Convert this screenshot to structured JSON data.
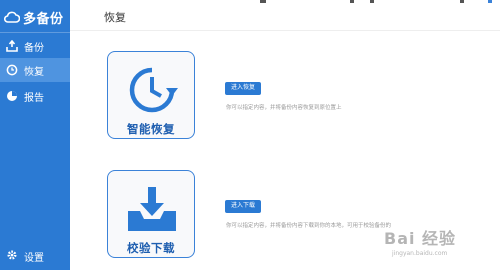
{
  "app": {
    "logo_text": "多备份"
  },
  "sidebar": {
    "items": [
      {
        "label": "备份",
        "icon": "backup-upload-icon"
      },
      {
        "label": "恢复",
        "icon": "history-icon",
        "active": true
      },
      {
        "label": "报告",
        "icon": "pie-chart-icon"
      }
    ],
    "settings_label": "设置"
  },
  "page": {
    "title": "恢复"
  },
  "restore": {
    "card_label": "智能恢复",
    "button_label": "进入恢复",
    "description": "你可以指定内容，并将备份内容恢复到原位置上"
  },
  "download": {
    "card_label": "校验下载",
    "button_label": "进入下载",
    "description": "你可以指定内容，并将备份内容下载到你的本地，可用于校验备份的"
  },
  "watermark": {
    "text": "Bai 经验",
    "sub": "jingyan.baidu.com"
  },
  "colors": {
    "sidebar": "#2b7ad3",
    "accent": "#3b82d8",
    "active_item": "#4f94e0"
  }
}
